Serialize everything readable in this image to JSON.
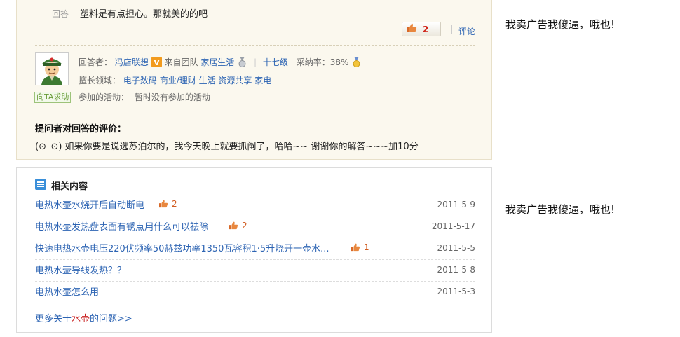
{
  "answer": {
    "label": "回答",
    "text": "塑料是有点担心。那就美的的吧",
    "like_count": "2",
    "comment_label": "评论"
  },
  "answerer": {
    "label": "回答者：",
    "name": "冯店联想",
    "team_prefix": "来自团队",
    "team": "家居生活",
    "level": "十七级",
    "adopt_label": "采纳率：38%",
    "expertise_label": "擅长领域：",
    "expertise": [
      "电子数码",
      "商业/理财",
      "生活",
      "资源共享",
      "家电"
    ],
    "activity_label": "参加的活动：",
    "activity": "暂时没有参加的活动",
    "help_button": "向TA求助"
  },
  "evaluation": {
    "title": "提问者对回答的评价：",
    "text": "(⊙_⊙) 如果你要是说选苏泊尔的，我今天晚上就要抓阄了，哈哈~~ 谢谢你的解答~~~加10分"
  },
  "related": {
    "title": "相关内容",
    "items": [
      {
        "title": "电热水壶水烧开后自动断电",
        "likes": "2",
        "date": "2011-5-9"
      },
      {
        "title": "电热水壶发热盘表面有锈点用什么可以祛除",
        "likes": "2",
        "date": "2011-5-17"
      },
      {
        "title": "快速电热水壶电压220伏频率50赫兹功率1350瓦容积1·5升烧开一壶水...",
        "likes": "1",
        "date": "2011-5-5"
      },
      {
        "title": "电热水壶导线发热？？",
        "likes": "",
        "date": "2011-5-8"
      },
      {
        "title": "电热水壶怎么用",
        "likes": "",
        "date": "2011-5-3"
      }
    ],
    "more_prefix": "更多关于",
    "more_keyword": "水壶",
    "more_suffix": "的问题>>"
  },
  "ads": [
    "我卖广告我傻逼，哦也!",
    "我卖广告我傻逼，哦也!"
  ],
  "colors": {
    "link": "#2d64b3",
    "like_red": "#d0251a",
    "panel_bg": "#fbf8ee",
    "help_green": "#669933"
  },
  "icons": [
    "thumb-up-icon",
    "v-badge-icon",
    "medal-icon",
    "related-list-icon",
    "avatar-soldier"
  ]
}
